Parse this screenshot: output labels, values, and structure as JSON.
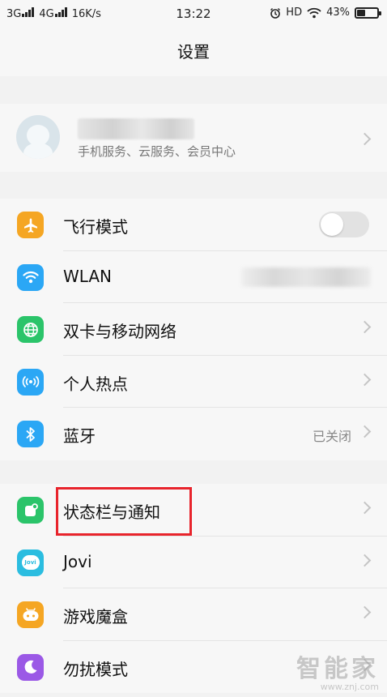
{
  "status_bar": {
    "signal1": "3G",
    "signal2": "4G",
    "speed": "16K/s",
    "time": "13:22",
    "hd": "HD",
    "battery_percent": "43%",
    "battery_level": 0.43
  },
  "header": {
    "title": "设置"
  },
  "account": {
    "subtitle": "手机服务、云服务、会员中心"
  },
  "group1": [
    {
      "label": "飞行模式",
      "icon": "airplane-icon",
      "color": "#f5a623",
      "control": "toggle",
      "on": false
    },
    {
      "label": "WLAN",
      "icon": "wifi-icon",
      "color": "#2ba7f5"
    },
    {
      "label": "双卡与移动网络",
      "icon": "globe-icon",
      "color": "#2bc46a"
    },
    {
      "label": "个人热点",
      "icon": "hotspot-icon",
      "color": "#2ba7f5"
    },
    {
      "label": "蓝牙",
      "icon": "bluetooth-icon",
      "color": "#2ba7f5",
      "value": "已关闭"
    }
  ],
  "group2": [
    {
      "label": "状态栏与通知",
      "icon": "notification-icon",
      "color": "#2bc46a"
    },
    {
      "label": "Jovi",
      "icon": "jovi-icon",
      "color": "#2bbde0",
      "icon_text": "Jovi"
    },
    {
      "label": "游戏魔盒",
      "icon": "gamepad-icon",
      "color": "#f5a623"
    },
    {
      "label": "勿扰模式",
      "icon": "moon-icon",
      "color": "#9b59e6"
    }
  ],
  "watermark": {
    "text": "智能家",
    "url": "www.znj.com"
  },
  "colors": {
    "highlight": "#e8242c"
  }
}
